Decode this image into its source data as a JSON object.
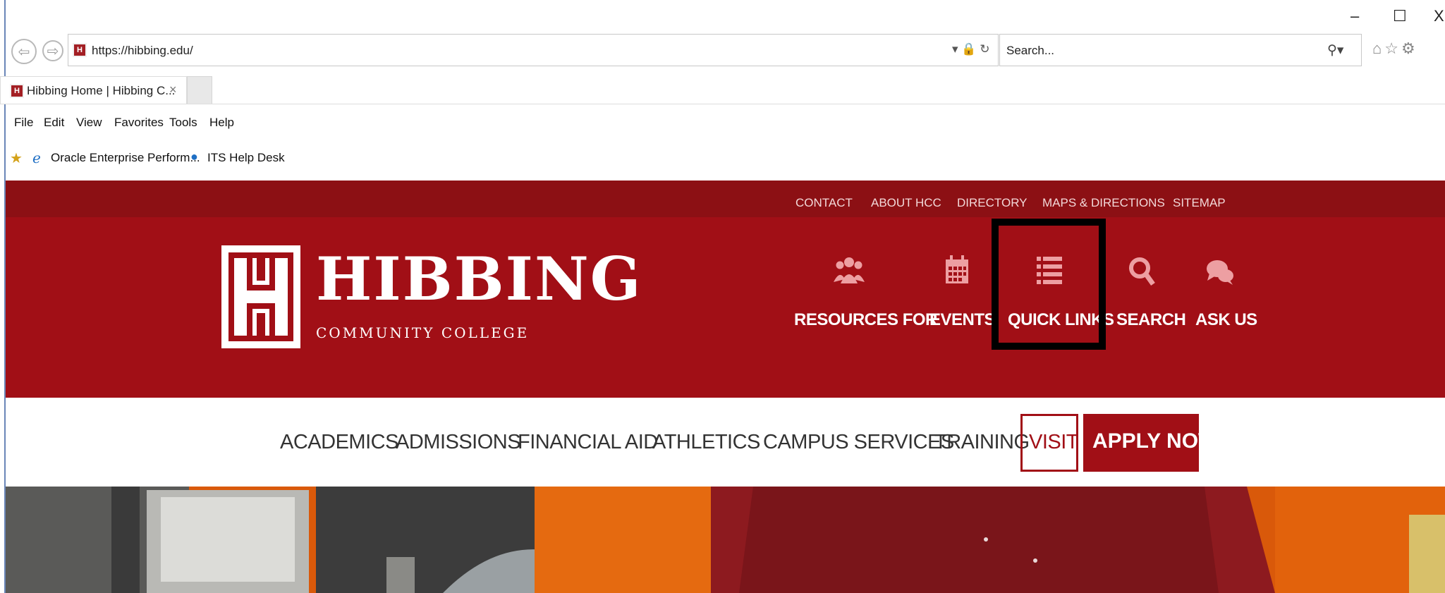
{
  "browser": {
    "url": "https://hibbing.edu/",
    "search_placeholder": "Search...",
    "tab_title": "Hibbing Home | Hibbing C...",
    "tab_close": "×",
    "window_controls": [
      "–",
      "☐",
      "X"
    ],
    "menu": [
      "File",
      "Edit",
      "View",
      "Favorites",
      "Tools",
      "Help"
    ],
    "favorites": [
      "Oracle Enterprise Perform...",
      "ITS Help Desk"
    ]
  },
  "site": {
    "utility_links": [
      "CONTACT",
      "ABOUT HCC",
      "DIRECTORY",
      "MAPS & DIRECTIONS",
      "SITEMAP"
    ],
    "logo_name": "HIBBING",
    "logo_sub": "COMMUNITY COLLEGE",
    "quick_nav": [
      {
        "label": "RESOURCES FOR",
        "icon": "users-icon"
      },
      {
        "label": "EVENTS",
        "icon": "calendar-icon"
      },
      {
        "label": "QUICK LINKS",
        "icon": "list-icon"
      },
      {
        "label": "SEARCH",
        "icon": "search-icon"
      },
      {
        "label": "ASK US",
        "icon": "chat-icon"
      }
    ],
    "main_nav": [
      "ACADEMICS",
      "ADMISSIONS",
      "FINANCIAL AID",
      "ATHLETICS",
      "CAMPUS SERVICES",
      "TRAINING",
      "VISIT",
      "APPLY NOW"
    ]
  },
  "colors": {
    "brand_red": "#a10f16",
    "utility_bar": "#8c1014",
    "icon_pink": "#ed9fa2",
    "highlight": "#000000"
  }
}
